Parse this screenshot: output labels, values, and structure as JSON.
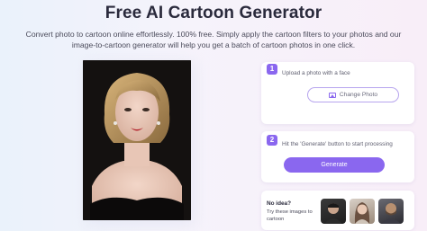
{
  "header": {
    "title": "Free AI Cartoon Generator",
    "subtitle_line1": "Convert photo to cartoon online effortlessly. 100% free. Simply apply the cartoon filters to your photos and our",
    "subtitle_line2": "image-to-cartoon generator will help you get a batch of cartoon photos in one click."
  },
  "step1": {
    "number": "1",
    "text": "Upload a photo with a face",
    "button_label": "Change Photo",
    "icon": "image-icon"
  },
  "step2": {
    "number": "2",
    "text": "Hit the 'Generate' button to start processing",
    "button_label": "Generate"
  },
  "ideas": {
    "label": "No idea?",
    "sub": "Try these images to cartoon",
    "thumbs": [
      "sample-man-1",
      "sample-woman",
      "sample-man-2"
    ]
  },
  "colors": {
    "accent": "#8a67ef",
    "title": "#2a2a3c"
  }
}
